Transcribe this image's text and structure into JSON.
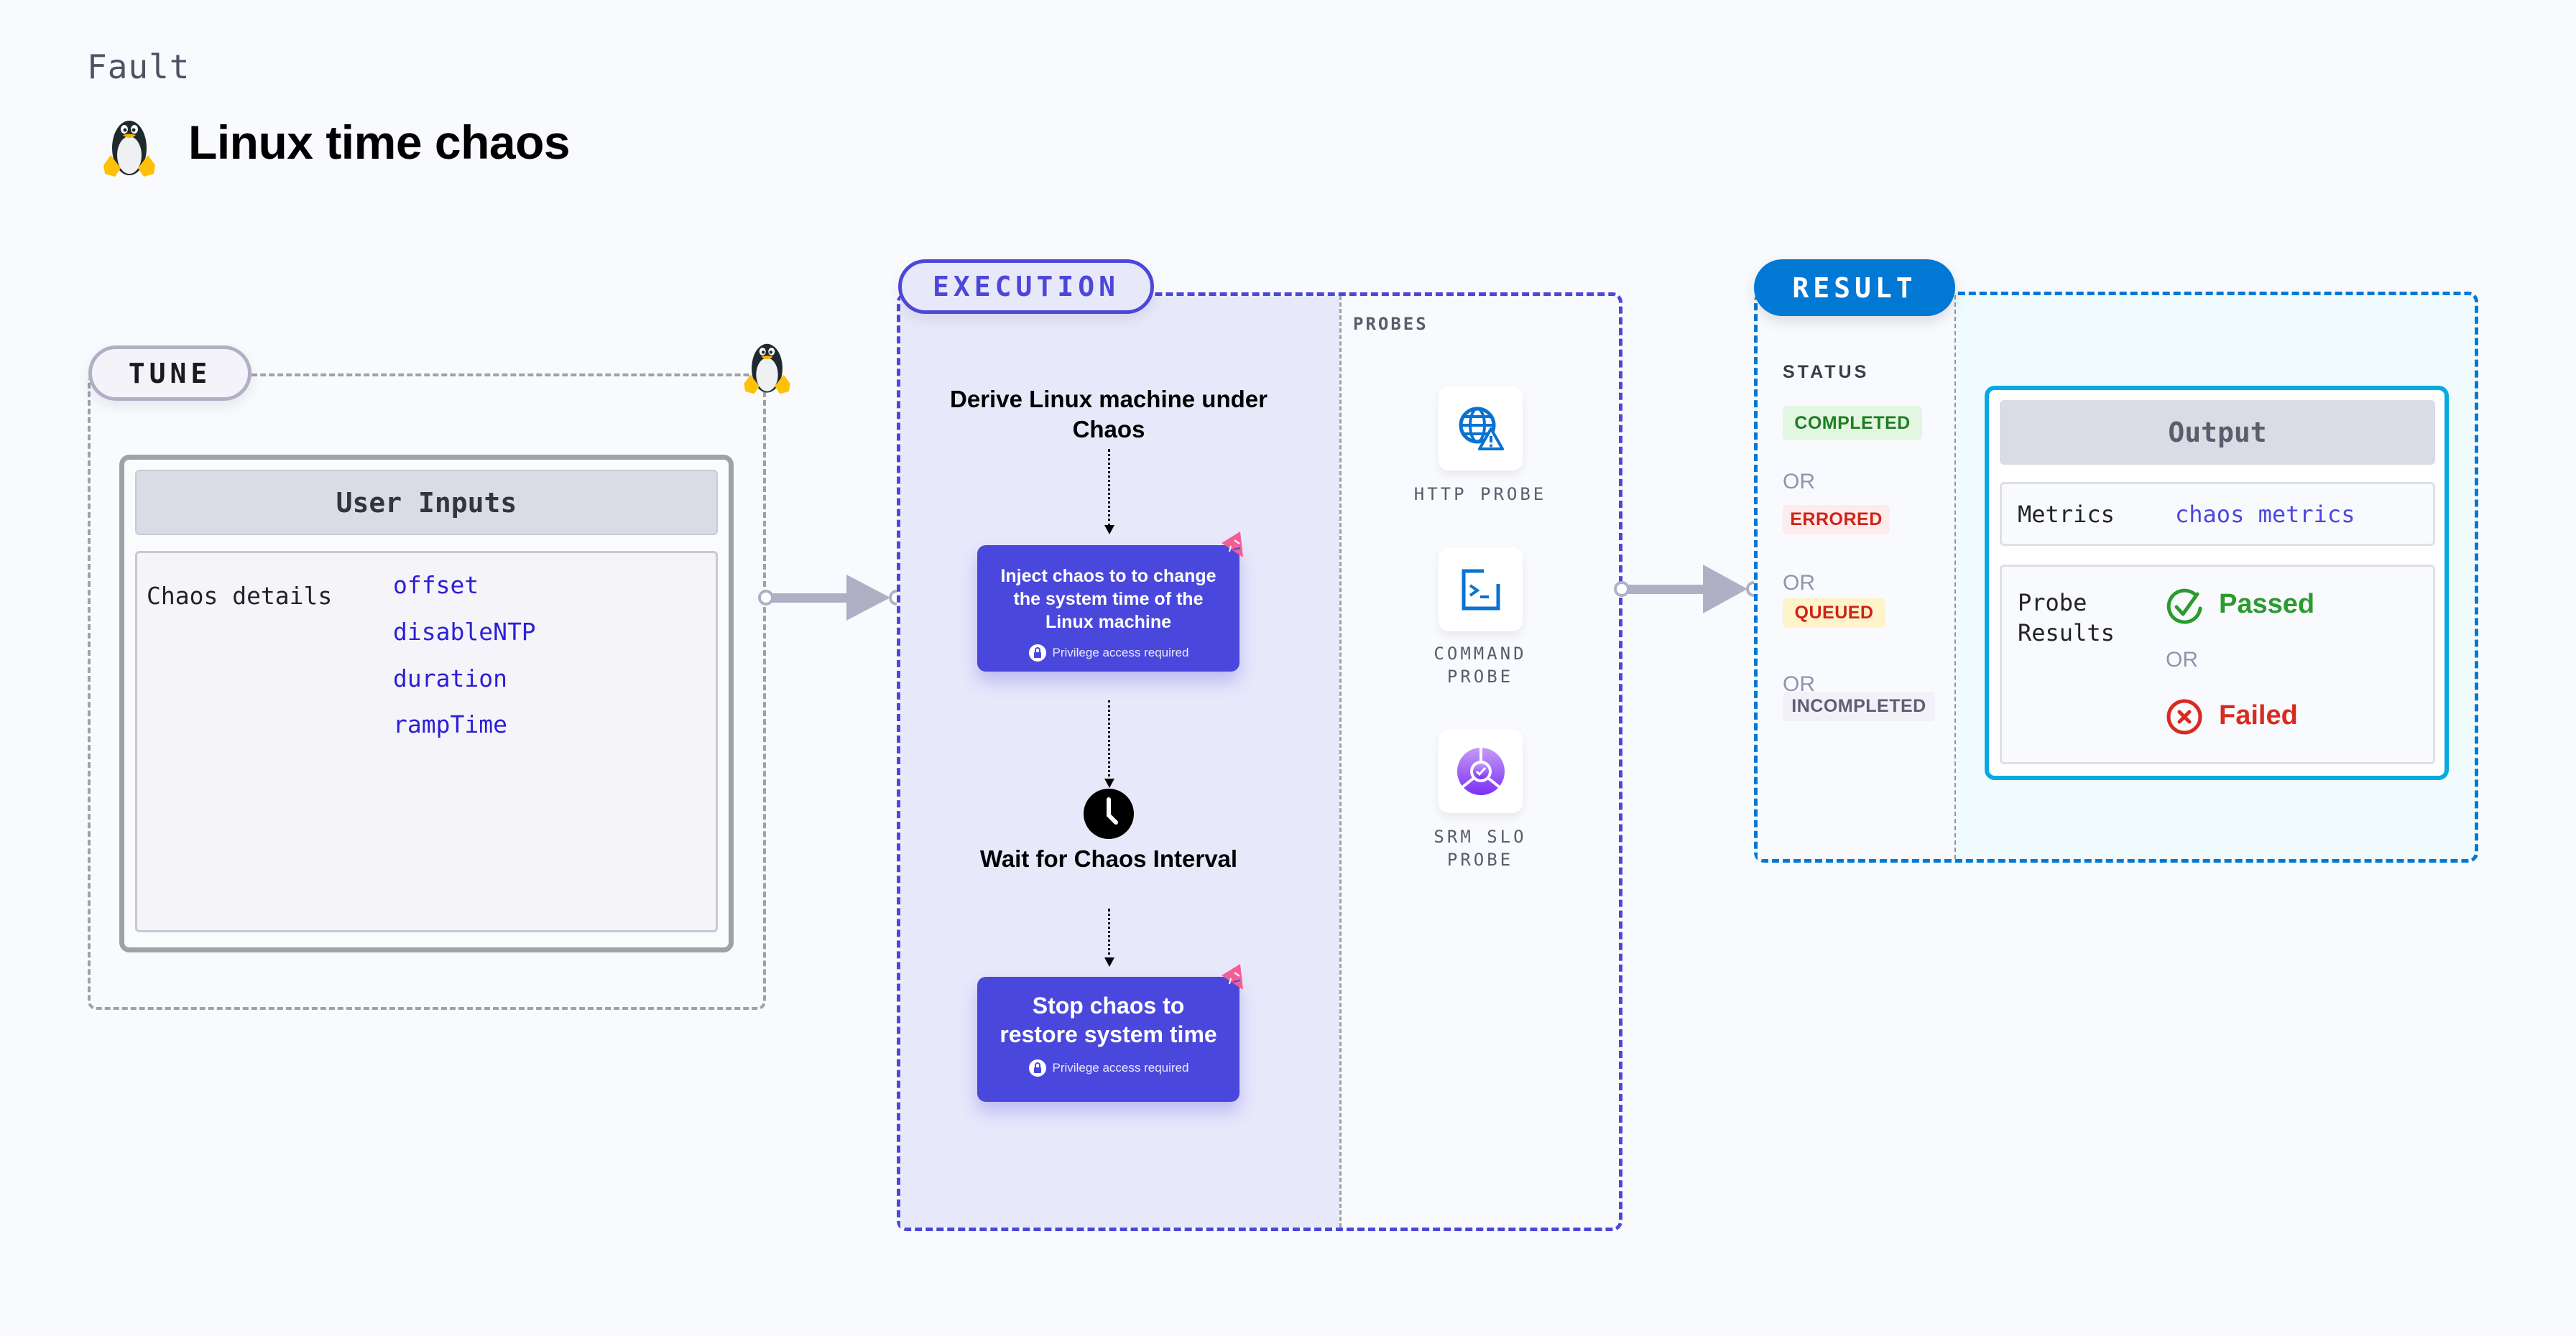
{
  "header": {
    "category": "Fault",
    "title": "Linux time chaos",
    "icon": "linux-penguin-icon"
  },
  "tune": {
    "pill_label": "TUNE",
    "icon": "linux-penguin-icon",
    "inputs_title": "User Inputs",
    "details_label": "Chaos details",
    "params": [
      "offset",
      "disableNTP",
      "duration",
      "rampTime"
    ]
  },
  "execution": {
    "pill_label": "EXECUTION",
    "steps": {
      "derive": "Derive Linux machine under Chaos",
      "inject": "Inject chaos to to change the system time of the Linux machine",
      "wait": "Wait for Chaos Interval",
      "stop": "Stop chaos to restore system time"
    },
    "privilege_note": "Privilege access required",
    "probes_label": "PROBES",
    "probes": [
      {
        "label": "HTTP PROBE",
        "icon": "globe-warning-icon"
      },
      {
        "label": "COMMAND PROBE",
        "icon": "terminal-icon"
      },
      {
        "label": "SRM SLO PROBE",
        "icon": "slo-gauge-icon"
      }
    ]
  },
  "result": {
    "pill_label": "RESULT",
    "status_label": "STATUS",
    "statuses": [
      {
        "label": "COMPLETED",
        "color": "#1e7e22",
        "bg": "#e3f6e2"
      },
      {
        "label": "ERRORED",
        "color": "#cf2318",
        "bg": "#fdeceb"
      },
      {
        "label": "QUEUED",
        "color": "#cf2318",
        "bg": "#fff3c9"
      },
      {
        "label": "INCOMPLETED",
        "color": "#5d5e75",
        "bg": "#f1f1f7"
      }
    ],
    "or_text": "OR",
    "output": {
      "title": "Output",
      "metrics_label": "Metrics",
      "metrics_value": "chaos metrics",
      "probe_results_label": "Probe Results",
      "passed": "Passed",
      "failed": "Failed"
    }
  },
  "colors": {
    "execution_accent": "#4c47d8",
    "result_accent": "#0278d5",
    "output_border": "#08a9e1",
    "step_card": "#4a48dc"
  }
}
